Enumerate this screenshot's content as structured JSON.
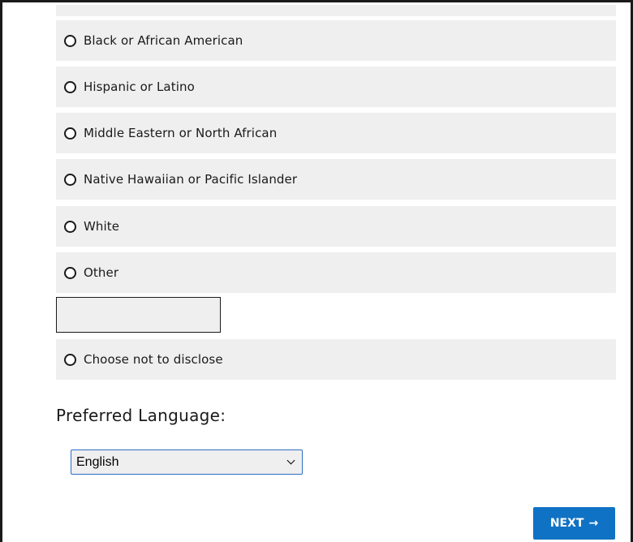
{
  "race_options": [
    {
      "label": ""
    },
    {
      "label": "Black or African American"
    },
    {
      "label": "Hispanic or Latino"
    },
    {
      "label": "Middle Eastern or North African"
    },
    {
      "label": "Native Hawaiian or Pacific Islander"
    },
    {
      "label": "White"
    },
    {
      "label": "Other"
    },
    {
      "label": "Choose not to disclose"
    }
  ],
  "other_input": {
    "value": "",
    "placeholder": ""
  },
  "language": {
    "label": "Preferred Language:",
    "selected": "English"
  },
  "next_button": {
    "label": "NEXT",
    "arrow": "→"
  },
  "colors": {
    "row_background": "#efefef",
    "button_background": "#0f72c4",
    "select_border": "#2d6ec4"
  }
}
